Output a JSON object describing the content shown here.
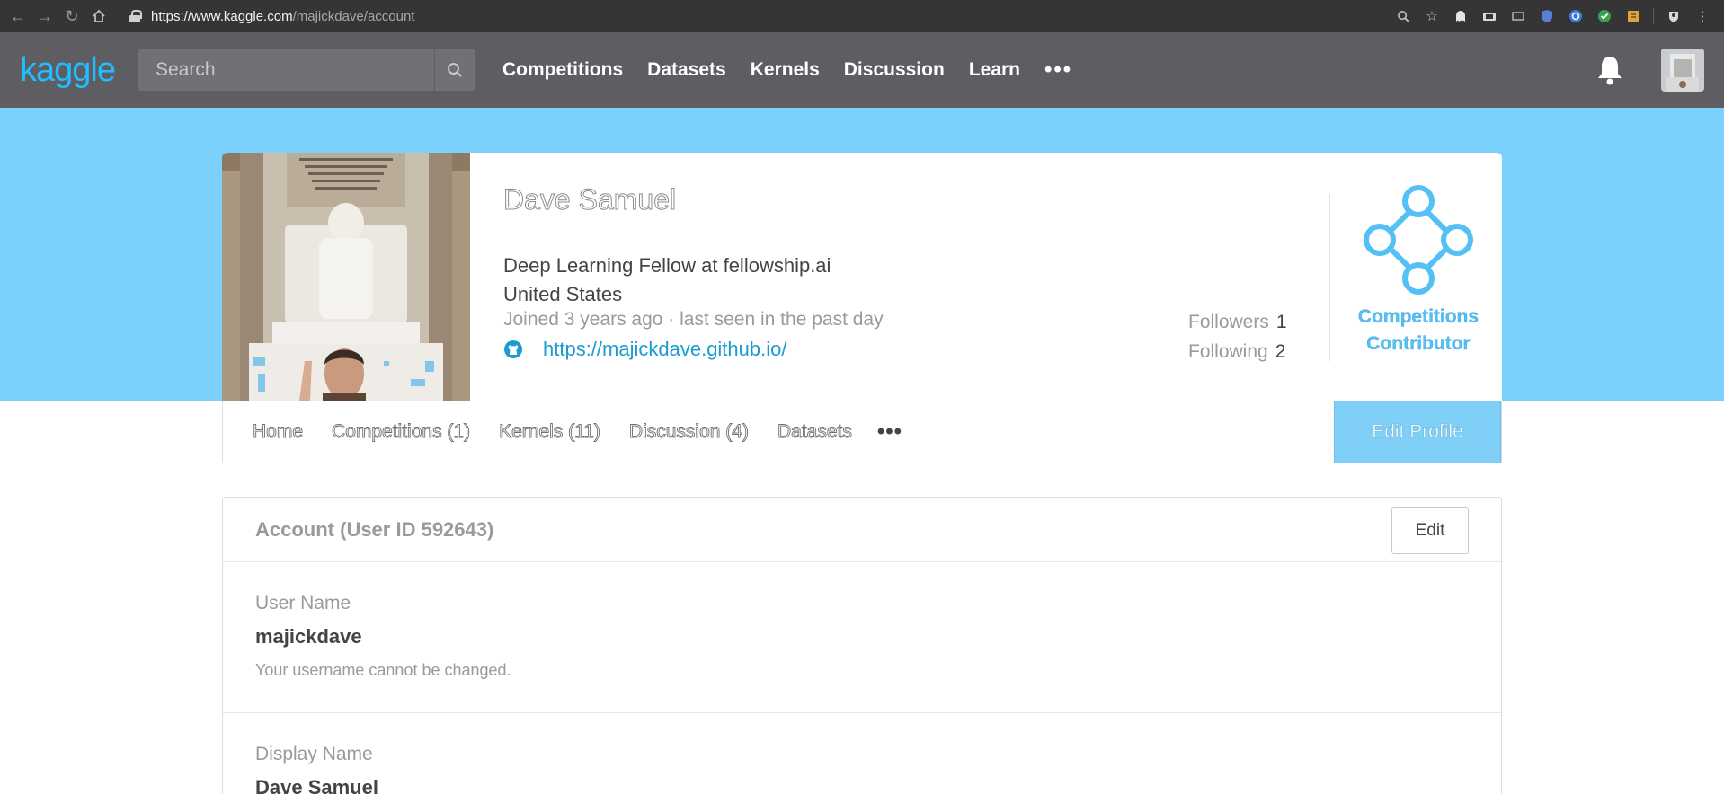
{
  "browser": {
    "url_host": "https://www.kaggle.com",
    "url_path": "/majickdave/account"
  },
  "header": {
    "logo": "kaggle",
    "search_placeholder": "Search",
    "nav": [
      "Competitions",
      "Datasets",
      "Kernels",
      "Discussion",
      "Learn"
    ],
    "more": "•••"
  },
  "profile": {
    "name": "Dave Samuel",
    "bio": "Deep Learning Fellow at fellowship.ai",
    "location": "United States",
    "joined": "Joined 3 years ago · last seen in the past day",
    "website": "https://majickdave.github.io/",
    "followers_label": "Followers",
    "followers": "1",
    "following_label": "Following",
    "following": "2",
    "tier_line1": "Competitions",
    "tier_line2": "Contributor"
  },
  "tabs": {
    "items": [
      "Home",
      "Competitions (1)",
      "Kernels (11)",
      "Discussion (4)",
      "Datasets"
    ],
    "more": "•••",
    "edit_profile": "Edit Profile"
  },
  "account": {
    "title": "Account (User ID 592643)",
    "edit": "Edit",
    "username_label": "User Name",
    "username": "majickdave",
    "username_hint": "Your username cannot be changed.",
    "display_name_label": "Display Name",
    "display_name": "Dave Samuel"
  }
}
